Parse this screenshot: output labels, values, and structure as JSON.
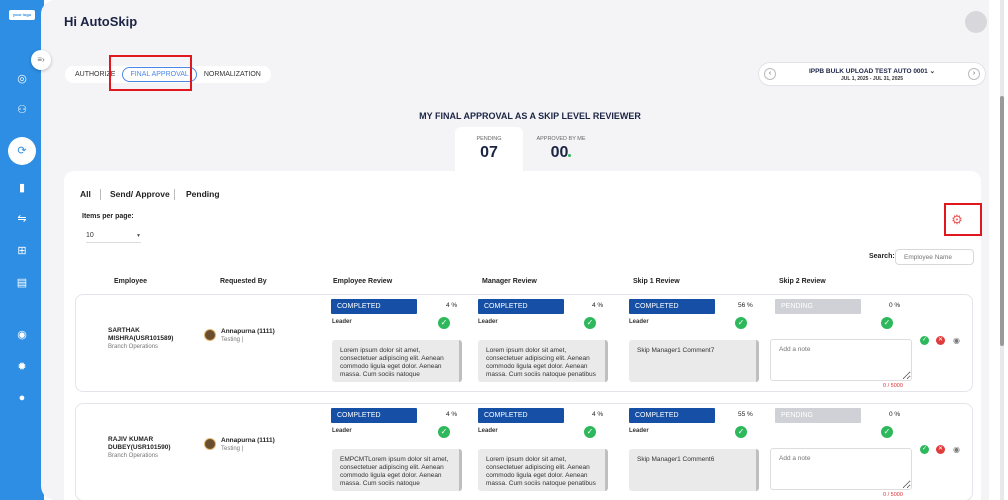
{
  "app": {
    "logo_text": "your logo",
    "greeting": "Hi AutoSkip"
  },
  "tabs": [
    {
      "label": "AUTHORIZE"
    },
    {
      "label": "FINAL APPROVAL"
    },
    {
      "label": "NORMALIZATION"
    }
  ],
  "cycle": {
    "title": "IPPB BULK UPLOAD TEST AUTO 0001",
    "date_range": "JUL 1, 2025 - JUL 31, 2025"
  },
  "section_title": "MY FINAL APPROVAL AS A SKIP LEVEL REVIEWER",
  "stats": {
    "pending": {
      "label": "PENDING",
      "value": "07"
    },
    "approved": {
      "label": "APPROVED BY ME",
      "value": "00"
    }
  },
  "filters": [
    "All",
    "Send/ Approve",
    "Pending"
  ],
  "items_per_page": {
    "label": "Items per page:",
    "value": "10"
  },
  "search": {
    "label": "Search:",
    "placeholder": "Employee Name"
  },
  "columns": [
    "Employee",
    "Requested By",
    "Employee Review",
    "Manager Review",
    "Skip 1 Review",
    "Skip 2 Review"
  ],
  "rows": [
    {
      "employee": "SARTHAK MISHRA(USR101589)",
      "dept": "Branch Operations",
      "requested_by": "Annapurna (1111)",
      "requested_sub": "Testing |",
      "emp_status": "COMPLETED",
      "emp_pct": "4 %",
      "emp_level": "Leader",
      "emp_comment": "Lorem ipsum dolor sit amet, consectetuer adipiscing elit. Aenean commodo ligula eget dolor. Aenean massa. Cum sociis natoque",
      "mgr_status": "COMPLETED",
      "mgr_pct": "4 %",
      "mgr_level": "Leader",
      "mgr_comment": "Lorem ipsum dolor sit amet, consectetuer adipiscing elit. Aenean commodo ligula eget dolor. Aenean massa. Cum sociis natoque penatibus",
      "s1_status": "COMPLETED",
      "s1_pct": "56 %",
      "s1_level": "Leader",
      "s1_comment": "Skip Manager1 Comment7",
      "s2_status": "PENDING",
      "s2_pct": "0 %",
      "note_placeholder": "Add a note",
      "counter": "0 / 5000"
    },
    {
      "employee": "RAJIV KUMAR DUBEY(USR101590)",
      "dept": "Branch Operations",
      "requested_by": "Annapurna (1111)",
      "requested_sub": "Testing |",
      "emp_status": "COMPLETED",
      "emp_pct": "4 %",
      "emp_level": "Leader",
      "emp_comment": "EMPCMTLorem ipsum dolor sit amet, consectetuer adipiscing elit. Aenean commodo ligula eget dolor. Aenean massa. Cum sociis natoque",
      "mgr_status": "COMPLETED",
      "mgr_pct": "4 %",
      "mgr_level": "Leader",
      "mgr_comment": "Lorem ipsum dolor sit amet, consectetuer adipiscing elit. Aenean commodo ligula eget dolor. Aenean massa. Cum sociis natoque penatibus",
      "s1_status": "COMPLETED",
      "s1_pct": "55 %",
      "s1_level": "Leader",
      "s1_comment": "Skip Manager1 Comment6",
      "s2_status": "PENDING",
      "s2_pct": "0 %",
      "note_placeholder": "Add a note",
      "counter": "0 / 5000"
    }
  ],
  "colors": {
    "sidebar": "#2e8ee3",
    "completed": "#1650a6",
    "pending": "#cfd1d6",
    "success": "#2eb85c",
    "highlight": "#e0181e"
  }
}
